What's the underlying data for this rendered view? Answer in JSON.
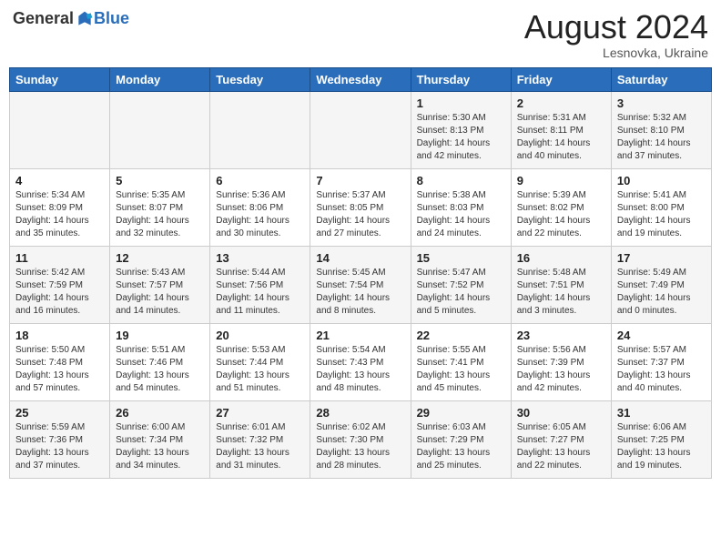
{
  "header": {
    "logo_general": "General",
    "logo_blue": "Blue",
    "month_year": "August 2024",
    "location": "Lesnovka, Ukraine"
  },
  "days_of_week": [
    "Sunday",
    "Monday",
    "Tuesday",
    "Wednesday",
    "Thursday",
    "Friday",
    "Saturday"
  ],
  "weeks": [
    [
      {
        "day": "",
        "info": ""
      },
      {
        "day": "",
        "info": ""
      },
      {
        "day": "",
        "info": ""
      },
      {
        "day": "",
        "info": ""
      },
      {
        "day": "1",
        "info": "Sunrise: 5:30 AM\nSunset: 8:13 PM\nDaylight: 14 hours\nand 42 minutes."
      },
      {
        "day": "2",
        "info": "Sunrise: 5:31 AM\nSunset: 8:11 PM\nDaylight: 14 hours\nand 40 minutes."
      },
      {
        "day": "3",
        "info": "Sunrise: 5:32 AM\nSunset: 8:10 PM\nDaylight: 14 hours\nand 37 minutes."
      }
    ],
    [
      {
        "day": "4",
        "info": "Sunrise: 5:34 AM\nSunset: 8:09 PM\nDaylight: 14 hours\nand 35 minutes."
      },
      {
        "day": "5",
        "info": "Sunrise: 5:35 AM\nSunset: 8:07 PM\nDaylight: 14 hours\nand 32 minutes."
      },
      {
        "day": "6",
        "info": "Sunrise: 5:36 AM\nSunset: 8:06 PM\nDaylight: 14 hours\nand 30 minutes."
      },
      {
        "day": "7",
        "info": "Sunrise: 5:37 AM\nSunset: 8:05 PM\nDaylight: 14 hours\nand 27 minutes."
      },
      {
        "day": "8",
        "info": "Sunrise: 5:38 AM\nSunset: 8:03 PM\nDaylight: 14 hours\nand 24 minutes."
      },
      {
        "day": "9",
        "info": "Sunrise: 5:39 AM\nSunset: 8:02 PM\nDaylight: 14 hours\nand 22 minutes."
      },
      {
        "day": "10",
        "info": "Sunrise: 5:41 AM\nSunset: 8:00 PM\nDaylight: 14 hours\nand 19 minutes."
      }
    ],
    [
      {
        "day": "11",
        "info": "Sunrise: 5:42 AM\nSunset: 7:59 PM\nDaylight: 14 hours\nand 16 minutes."
      },
      {
        "day": "12",
        "info": "Sunrise: 5:43 AM\nSunset: 7:57 PM\nDaylight: 14 hours\nand 14 minutes."
      },
      {
        "day": "13",
        "info": "Sunrise: 5:44 AM\nSunset: 7:56 PM\nDaylight: 14 hours\nand 11 minutes."
      },
      {
        "day": "14",
        "info": "Sunrise: 5:45 AM\nSunset: 7:54 PM\nDaylight: 14 hours\nand 8 minutes."
      },
      {
        "day": "15",
        "info": "Sunrise: 5:47 AM\nSunset: 7:52 PM\nDaylight: 14 hours\nand 5 minutes."
      },
      {
        "day": "16",
        "info": "Sunrise: 5:48 AM\nSunset: 7:51 PM\nDaylight: 14 hours\nand 3 minutes."
      },
      {
        "day": "17",
        "info": "Sunrise: 5:49 AM\nSunset: 7:49 PM\nDaylight: 14 hours\nand 0 minutes."
      }
    ],
    [
      {
        "day": "18",
        "info": "Sunrise: 5:50 AM\nSunset: 7:48 PM\nDaylight: 13 hours\nand 57 minutes."
      },
      {
        "day": "19",
        "info": "Sunrise: 5:51 AM\nSunset: 7:46 PM\nDaylight: 13 hours\nand 54 minutes."
      },
      {
        "day": "20",
        "info": "Sunrise: 5:53 AM\nSunset: 7:44 PM\nDaylight: 13 hours\nand 51 minutes."
      },
      {
        "day": "21",
        "info": "Sunrise: 5:54 AM\nSunset: 7:43 PM\nDaylight: 13 hours\nand 48 minutes."
      },
      {
        "day": "22",
        "info": "Sunrise: 5:55 AM\nSunset: 7:41 PM\nDaylight: 13 hours\nand 45 minutes."
      },
      {
        "day": "23",
        "info": "Sunrise: 5:56 AM\nSunset: 7:39 PM\nDaylight: 13 hours\nand 42 minutes."
      },
      {
        "day": "24",
        "info": "Sunrise: 5:57 AM\nSunset: 7:37 PM\nDaylight: 13 hours\nand 40 minutes."
      }
    ],
    [
      {
        "day": "25",
        "info": "Sunrise: 5:59 AM\nSunset: 7:36 PM\nDaylight: 13 hours\nand 37 minutes."
      },
      {
        "day": "26",
        "info": "Sunrise: 6:00 AM\nSunset: 7:34 PM\nDaylight: 13 hours\nand 34 minutes."
      },
      {
        "day": "27",
        "info": "Sunrise: 6:01 AM\nSunset: 7:32 PM\nDaylight: 13 hours\nand 31 minutes."
      },
      {
        "day": "28",
        "info": "Sunrise: 6:02 AM\nSunset: 7:30 PM\nDaylight: 13 hours\nand 28 minutes."
      },
      {
        "day": "29",
        "info": "Sunrise: 6:03 AM\nSunset: 7:29 PM\nDaylight: 13 hours\nand 25 minutes."
      },
      {
        "day": "30",
        "info": "Sunrise: 6:05 AM\nSunset: 7:27 PM\nDaylight: 13 hours\nand 22 minutes."
      },
      {
        "day": "31",
        "info": "Sunrise: 6:06 AM\nSunset: 7:25 PM\nDaylight: 13 hours\nand 19 minutes."
      }
    ]
  ]
}
